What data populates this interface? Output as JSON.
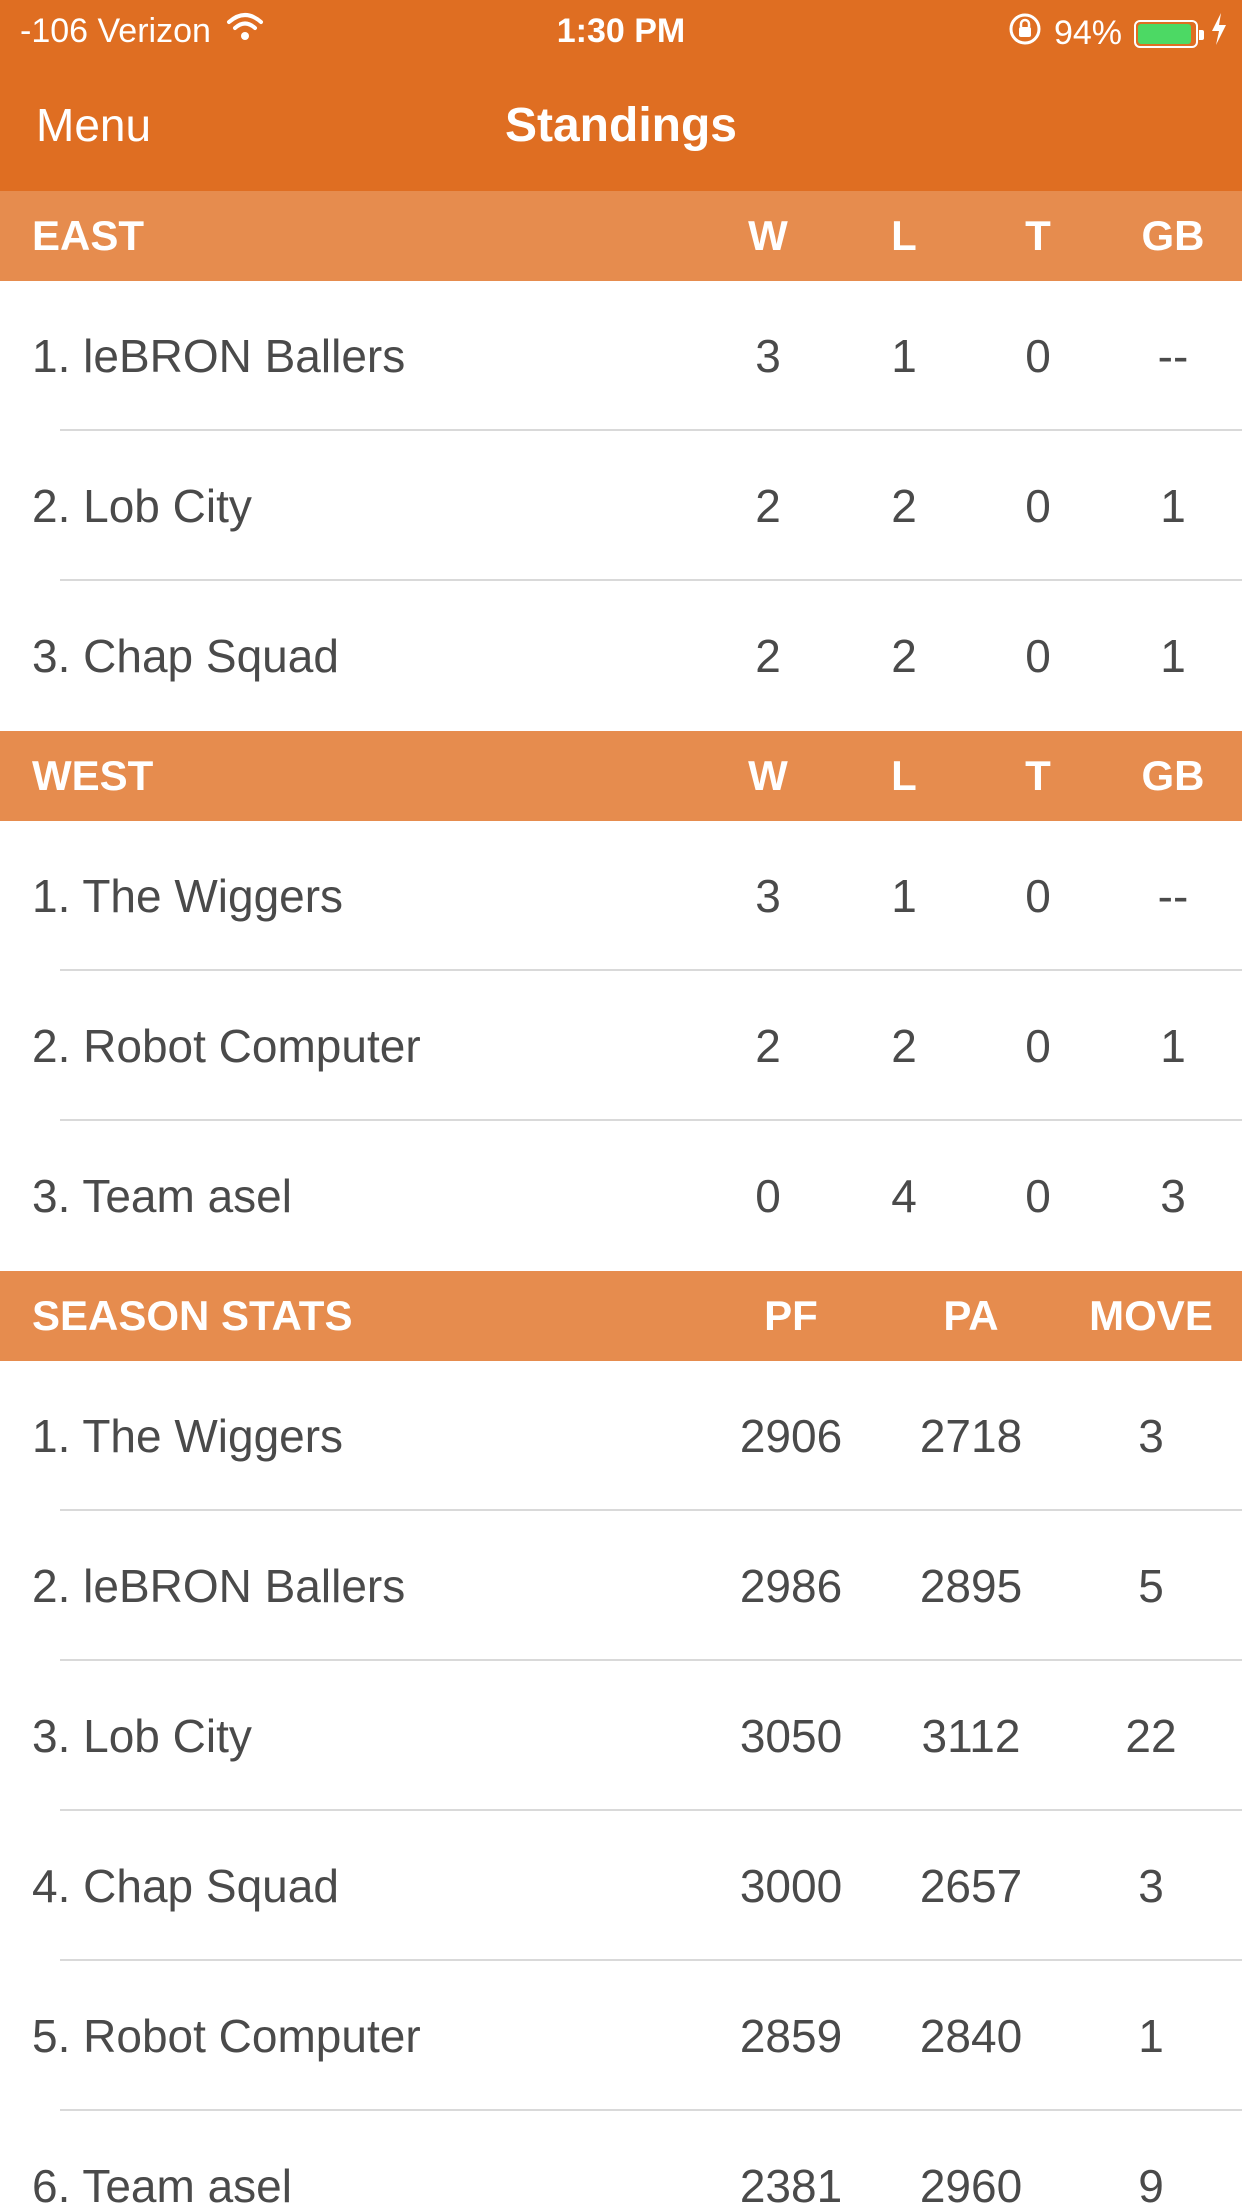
{
  "status_bar": {
    "signal": "-106 Verizon",
    "time": "1:30 PM",
    "battery_percent": "94%",
    "battery_level": 0.94,
    "icons": [
      "wifi-icon",
      "orientation-lock-icon",
      "battery-icon",
      "charging-bolt-icon"
    ]
  },
  "nav": {
    "menu_label": "Menu",
    "title": "Standings"
  },
  "colors": {
    "bar": "#df6e22",
    "header": "#e68c4e",
    "text": "#4a4a4a",
    "battery": "#4cd964"
  },
  "east": {
    "title": "EAST",
    "columns": [
      "W",
      "L",
      "T",
      "GB"
    ],
    "rows": [
      {
        "name": "1. leBRON Ballers",
        "w": "3",
        "l": "1",
        "t": "0",
        "gb": "--"
      },
      {
        "name": "2. Lob City",
        "w": "2",
        "l": "2",
        "t": "0",
        "gb": "1"
      },
      {
        "name": "3. Chap Squad",
        "w": "2",
        "l": "2",
        "t": "0",
        "gb": "1"
      }
    ]
  },
  "west": {
    "title": "WEST",
    "columns": [
      "W",
      "L",
      "T",
      "GB"
    ],
    "rows": [
      {
        "name": "1. The Wiggers",
        "w": "3",
        "l": "1",
        "t": "0",
        "gb": "--"
      },
      {
        "name": "2. Robot Computer",
        "w": "2",
        "l": "2",
        "t": "0",
        "gb": "1"
      },
      {
        "name": "3. Team asel",
        "w": "0",
        "l": "4",
        "t": "0",
        "gb": "3"
      }
    ]
  },
  "season": {
    "title": "SEASON STATS",
    "columns": [
      "PF",
      "PA",
      "MOVE"
    ],
    "rows": [
      {
        "name": "1. The Wiggers",
        "pf": "2906",
        "pa": "2718",
        "move": "3"
      },
      {
        "name": "2. leBRON Ballers",
        "pf": "2986",
        "pa": "2895",
        "move": "5"
      },
      {
        "name": "3. Lob City",
        "pf": "3050",
        "pa": "3112",
        "move": "22"
      },
      {
        "name": "4. Chap Squad",
        "pf": "3000",
        "pa": "2657",
        "move": "3"
      },
      {
        "name": "5. Robot Computer",
        "pf": "2859",
        "pa": "2840",
        "move": "1"
      },
      {
        "name": "6. Team asel",
        "pf": "2381",
        "pa": "2960",
        "move": "9"
      }
    ]
  }
}
